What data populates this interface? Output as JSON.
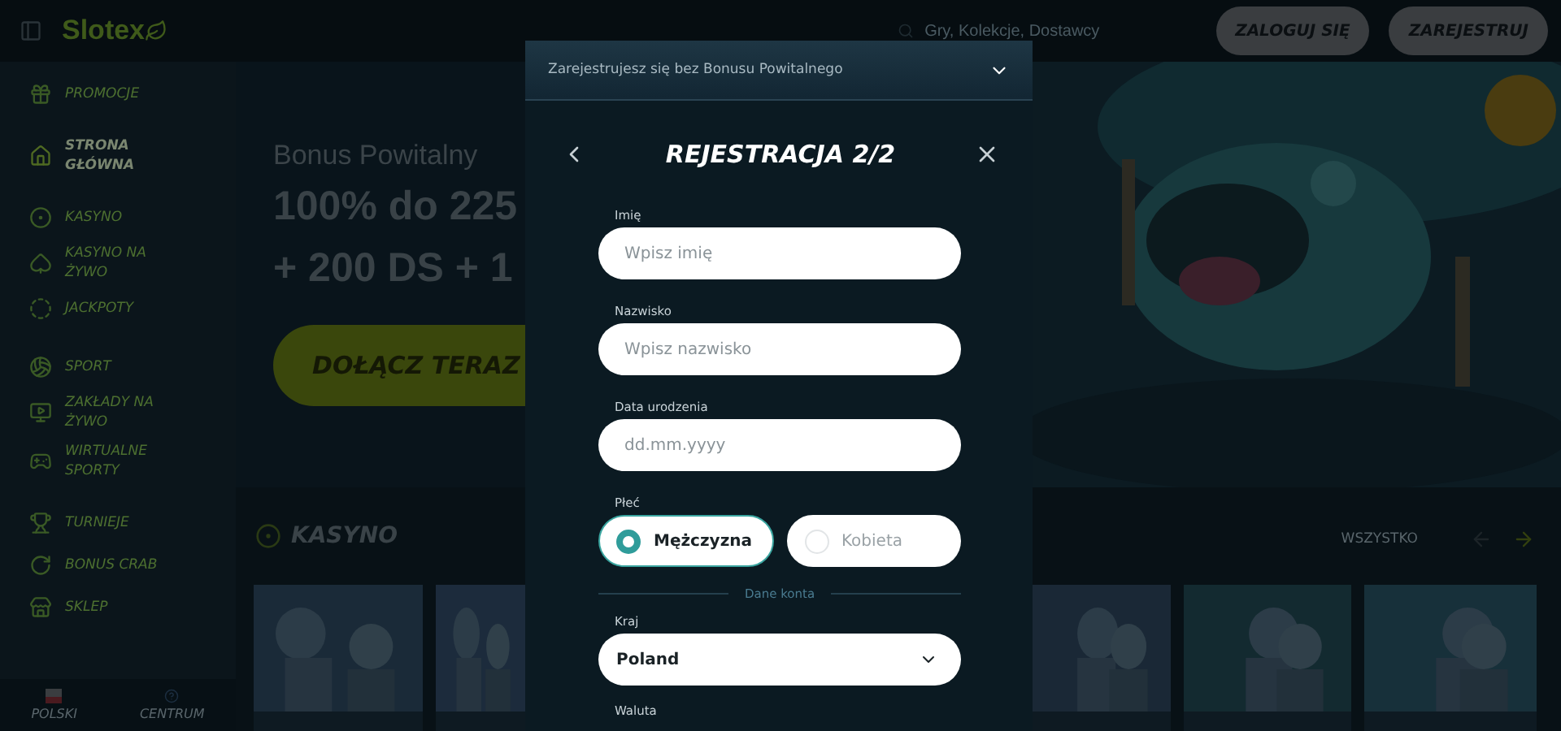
{
  "header": {
    "logo": "Slotex",
    "search": {
      "placeholder": "Gry, Kolekcje, Dostawcy"
    },
    "buttons": [
      "ZALOGUJ SIĘ",
      "ZAREJESTRUJ"
    ]
  },
  "sidebar": {
    "groups": [
      {
        "items": [
          {
            "label": "PROMOCJE",
            "selected": false
          }
        ]
      },
      {
        "items": [
          {
            "label": "STRONA GŁÓWNA",
            "selected": true
          }
        ]
      },
      {
        "items": [
          {
            "label": "KASYNO",
            "selected": false
          },
          {
            "label": "KASYNO NA ŻYWO",
            "selected": false
          },
          {
            "label": "JACKPOTY",
            "selected": false
          }
        ]
      },
      {
        "items": [
          {
            "label": "SPORT",
            "selected": false
          },
          {
            "label": "ZAKŁADY NA ŻYWO",
            "selected": false
          },
          {
            "label": "WIRTUALNE SPORTY",
            "selected": false
          }
        ]
      },
      {
        "items": [
          {
            "label": "TURNIEJE",
            "selected": false
          },
          {
            "label": "BONUS CRAB",
            "selected": false
          },
          {
            "label": "SKLEP",
            "selected": false
          }
        ]
      }
    ],
    "footer": [
      "POLSKI",
      "CENTRUM"
    ]
  },
  "hero": {
    "title": "Bonus Powitalny",
    "lines": [
      "100% do 225",
      "+ 200 DS + 1"
    ],
    "cta": "DOŁĄCZ TERAZ"
  },
  "section": {
    "title": "KASYNO",
    "link": "WSZYSTKO"
  },
  "modal": {
    "banner": "Zarejestrujesz się bez Bonusu Powitalnego",
    "title": "REJESTRACJA 2/2",
    "fields": [
      {
        "label": "Imię",
        "placeholder": "Wpisz imię"
      },
      {
        "label": "Nazwisko",
        "placeholder": "Wpisz nazwisko"
      },
      {
        "label": "Data urodzenia",
        "placeholder": "dd.mm.yyyy"
      }
    ],
    "gender": {
      "label": "Płeć",
      "options": [
        {
          "label": "Mężczyzna",
          "selected": true
        },
        {
          "label": "Kobieta",
          "selected": false
        }
      ]
    },
    "divider": "Dane konta",
    "country": {
      "label": "Kraj",
      "value": "Poland"
    },
    "currency": {
      "label": "Waluta"
    }
  }
}
